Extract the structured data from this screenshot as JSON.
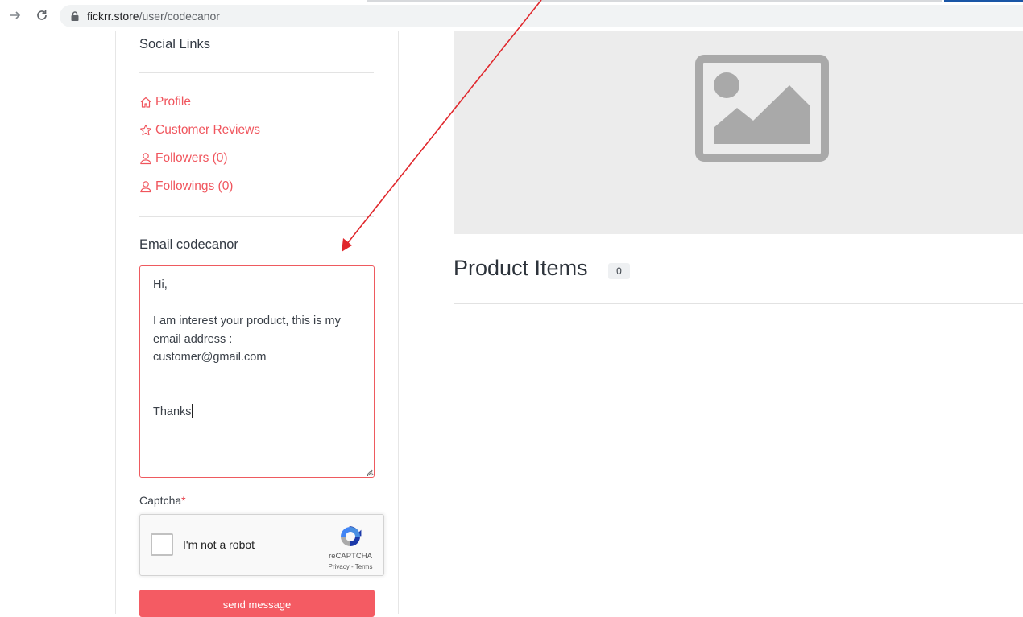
{
  "browser": {
    "url_host": "fickrr.store",
    "url_path": "/user/codecanor"
  },
  "sidebar": {
    "social_title": "Social Links",
    "links": [
      {
        "label": "Profile",
        "icon": "home-icon"
      },
      {
        "label": "Customer Reviews",
        "icon": "star-icon"
      },
      {
        "label": "Followers (0)",
        "icon": "user-icon"
      },
      {
        "label": "Followings (0)",
        "icon": "user-icon"
      }
    ],
    "email_title": "Email codecanor",
    "message": {
      "greeting": "Hi,",
      "line1": "I am interest your product, this is my",
      "line2": "email address :",
      "line3": "customer@gmail.com",
      "closing": "Thanks"
    },
    "captcha_label": "Captcha",
    "captcha_required": "*",
    "recaptcha": {
      "checkbox_label": "I'm not a robot",
      "brand": "reCAPTCHA",
      "terms": "Privacy - Terms"
    },
    "send_button": "send message"
  },
  "main": {
    "heading": "Product Items",
    "count": "0",
    "image_placeholder_icon": "image-placeholder-icon"
  },
  "colors": {
    "accent": "#f0555d",
    "button": "#f45b63",
    "arrow": "#e0262b"
  }
}
